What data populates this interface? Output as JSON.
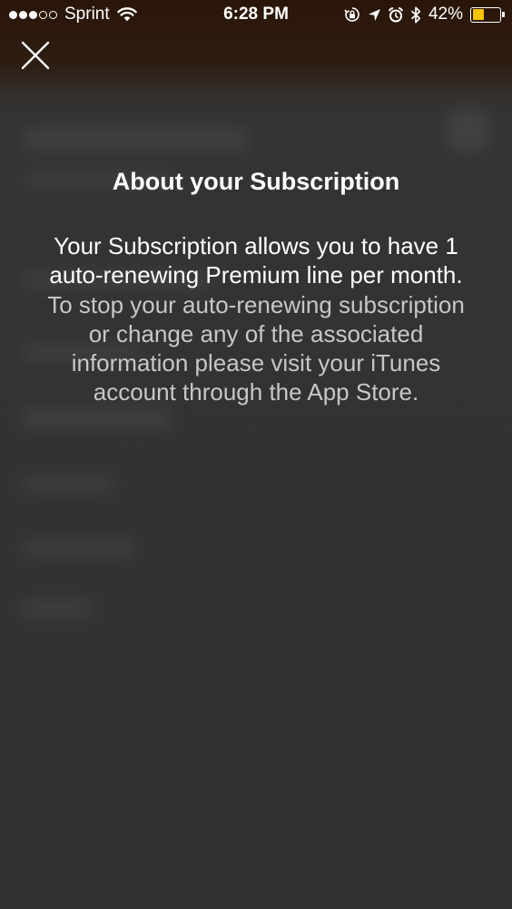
{
  "status_bar": {
    "carrier": "Sprint",
    "time": "6:28 PM",
    "battery_percent": "42%",
    "battery_level": 0.42,
    "signal_bars_filled": 3,
    "signal_bars_total": 5,
    "battery_color": "#f5c400",
    "icons": [
      "wifi-icon",
      "orientation-lock-icon",
      "location-arrow-icon",
      "alarm-icon",
      "bluetooth-icon",
      "battery-icon"
    ]
  },
  "close_button": {
    "icon": "close-icon"
  },
  "modal": {
    "title": "About your Subscription",
    "body_primary": "Your Subscription allows you to have 1 auto-renewing Premium line per month.",
    "body_secondary": "To stop your auto-renewing subscription or change any of the associated information please visit your iTunes account through the App Store."
  },
  "colors": {
    "background": "#323232",
    "header_tint": "#2a1608",
    "text_primary": "#ffffff",
    "text_secondary": "#c7c7c7"
  }
}
